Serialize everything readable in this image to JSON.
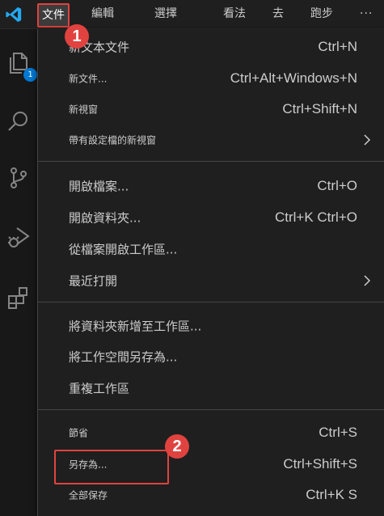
{
  "menubar": {
    "items": [
      {
        "label": "文件"
      },
      {
        "label": "編輯"
      },
      {
        "label": "選擇"
      },
      {
        "label": "看法"
      },
      {
        "label": "去"
      },
      {
        "label": "跑步"
      }
    ],
    "more_label": "···"
  },
  "activitybar": {
    "badge_count": "1",
    "icons": [
      "explorer-icon",
      "search-icon",
      "source-control-icon",
      "run-debug-icon",
      "extensions-icon"
    ]
  },
  "file_menu": {
    "items": [
      {
        "label": "新文本文件",
        "shortcut": "Ctrl+N"
      },
      {
        "label": "新文件...",
        "shortcut": "Ctrl+Alt+Windows+N"
      },
      {
        "label": "新視窗",
        "shortcut": "Ctrl+Shift+N"
      },
      {
        "label": "帶有設定檔的新視窗",
        "shortcut": ""
      },
      {
        "label": "開啟檔案...",
        "shortcut": "Ctrl+O"
      },
      {
        "label": "開啟資料夾...",
        "shortcut": "Ctrl+K Ctrl+O"
      },
      {
        "label": "從檔案開啟工作區...",
        "shortcut": ""
      },
      {
        "label": "最近打開",
        "shortcut": ""
      },
      {
        "label": "將資料夾新增至工作區...",
        "shortcut": ""
      },
      {
        "label": "將工作空間另存為...",
        "shortcut": ""
      },
      {
        "label": "重複工作區",
        "shortcut": ""
      },
      {
        "label": "節省",
        "shortcut": "Ctrl+S"
      },
      {
        "label": "另存為...",
        "shortcut": "Ctrl+Shift+S"
      },
      {
        "label": "全部保存",
        "shortcut": "Ctrl+K S"
      }
    ]
  },
  "callouts": {
    "step1": "1",
    "step2": "2"
  },
  "colors": {
    "accent_red": "#e0433f",
    "menu_bg": "#1f1f1f",
    "text": "#cccccc",
    "badge_blue": "#0078d4",
    "logo_blue": "#23a9f2"
  }
}
